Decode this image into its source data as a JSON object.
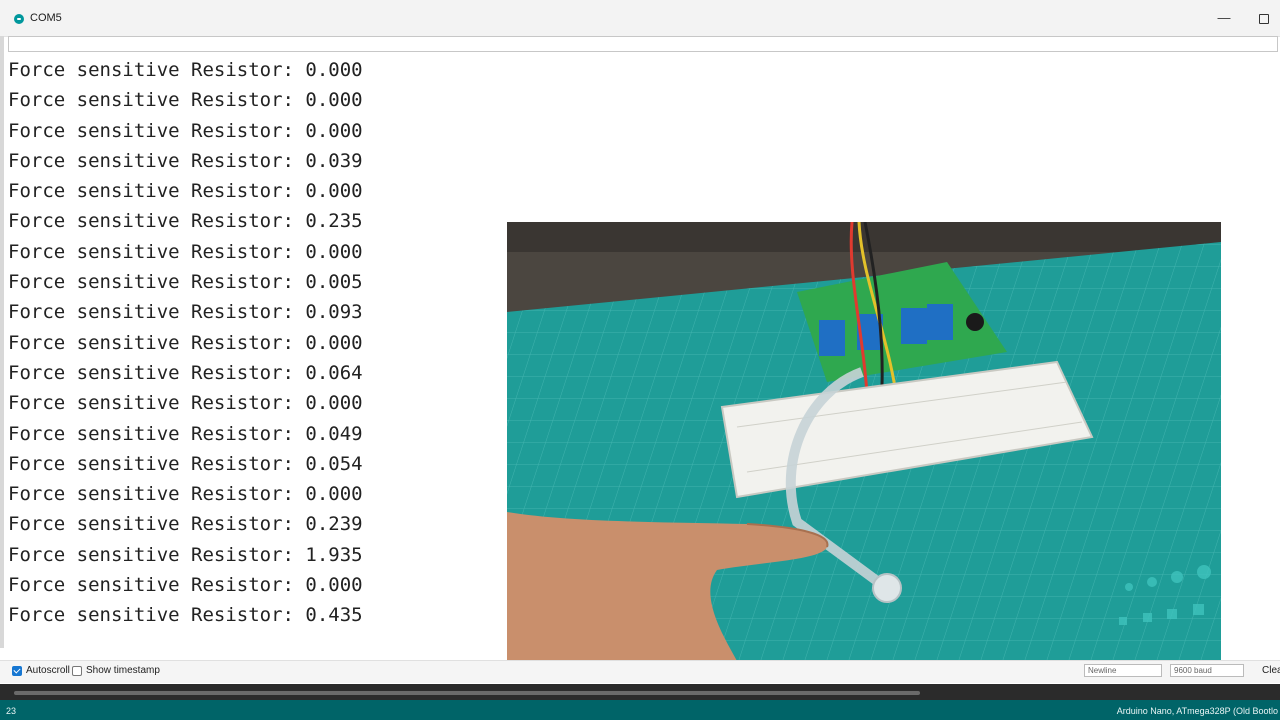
{
  "window": {
    "title": "COM5",
    "minimize_glyph": "—",
    "icon": "arduino-icon",
    "maximize_icon": "maximize-icon"
  },
  "send": {
    "value": ""
  },
  "serial": {
    "lines": [
      "Force sensitive Resistor: 0.000",
      "Force sensitive Resistor: 0.000",
      "Force sensitive Resistor: 0.000",
      "Force sensitive Resistor: 0.039",
      "Force sensitive Resistor: 0.000",
      "Force sensitive Resistor: 0.235",
      "Force sensitive Resistor: 0.000",
      "Force sensitive Resistor: 0.005",
      "Force sensitive Resistor: 0.093",
      "Force sensitive Resistor: 0.000",
      "Force sensitive Resistor: 0.064",
      "Force sensitive Resistor: 0.000",
      "Force sensitive Resistor: 0.049",
      "Force sensitive Resistor: 0.054",
      "Force sensitive Resistor: 0.000",
      "Force sensitive Resistor: 0.239",
      "Force sensitive Resistor: 1.935",
      "Force sensitive Resistor: 0.000",
      "Force sensitive Resistor: 0.435"
    ]
  },
  "bottom": {
    "autoscroll_label": "Autoscroll",
    "autoscroll_checked": true,
    "timestamp_label": "Show timestamp",
    "timestamp_checked": false,
    "line_ending": "Newline",
    "baud": "9600 baud",
    "clear_label": "Clea"
  },
  "status": {
    "line": "23",
    "board": "Arduino Nano, ATmega328P (Old Bootlo"
  },
  "colors": {
    "accent": "#00979c",
    "status_bar": "#006468",
    "checkbox": "#1677d2",
    "cutting_mat": "#1f9d98"
  }
}
